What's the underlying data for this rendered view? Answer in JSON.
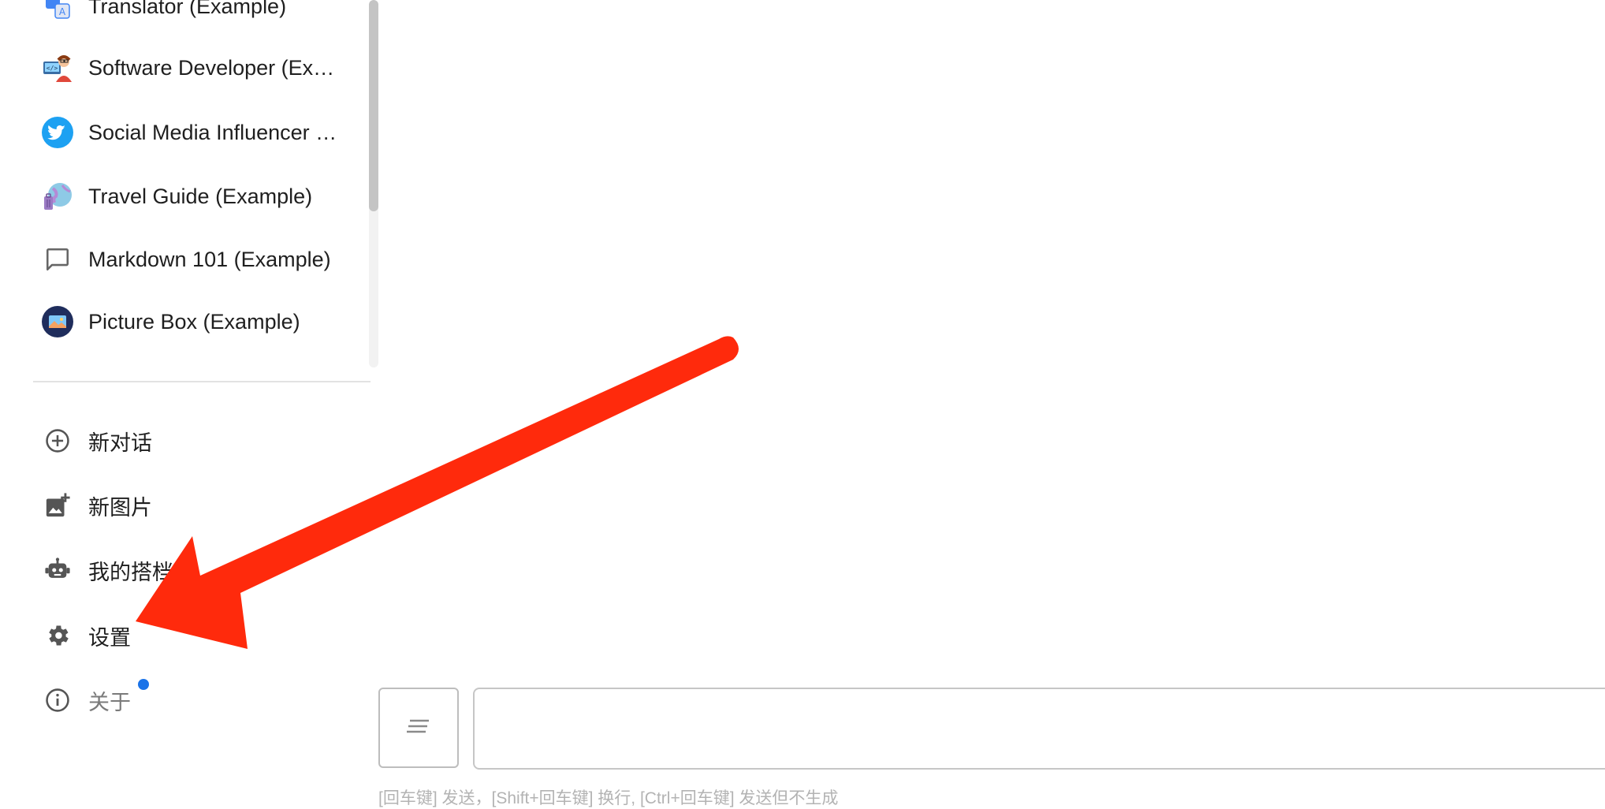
{
  "conversations": [
    {
      "label": "Translator (Example)",
      "icon": "translator-icon"
    },
    {
      "label": "Software Developer (Ex…",
      "icon": "software-developer-avatar-icon"
    },
    {
      "label": "Social Media Influencer …",
      "icon": "twitter-bird-icon"
    },
    {
      "label": "Travel Guide (Example)",
      "icon": "travel-globe-icon"
    },
    {
      "label": "Markdown 101 (Example)",
      "icon": "chat-bubble-icon"
    },
    {
      "label": "Picture Box (Example)",
      "icon": "picture-box-icon"
    }
  ],
  "menu": {
    "new_chat": "新对话",
    "new_image": "新图片",
    "my_copilots": "我的搭档",
    "settings": "设置",
    "about": "关于"
  },
  "input": {
    "placeholder": "",
    "hint": "[回车键] 发送，[Shift+回车键] 换行, [Ctrl+回车键] 发送但不生成"
  },
  "colors": {
    "arrow": "#ff2a0c",
    "notification_dot": "#1a73e8",
    "twitter_blue": "#1da1f2"
  }
}
